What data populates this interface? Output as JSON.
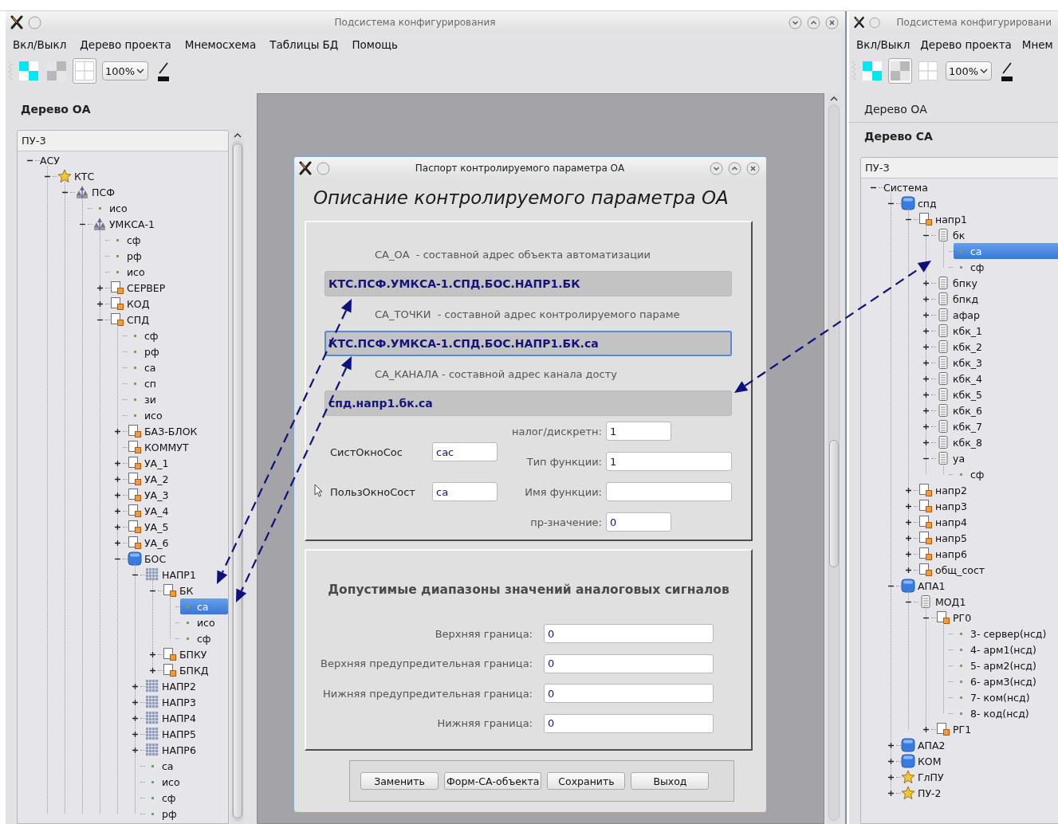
{
  "left_window": {
    "title": "Подсистема конфигурирования",
    "menu": [
      "Вкл/Выкл",
      "Дерево проекта",
      "Мнемосхема",
      "Таблицы БД",
      "Помощь"
    ],
    "toolbar": {
      "tools": [
        {
          "kind": "color",
          "pressed": false
        },
        {
          "kind": "shade",
          "pressed": false
        },
        {
          "kind": "grid",
          "pressed": true
        }
      ],
      "zoom": "100%"
    },
    "dock": {
      "sections": [
        {
          "label": "Дерево ОА",
          "selected": true
        }
      ],
      "tree": {
        "header": "ПУ-3",
        "nodes": [
          {
            "label": "АСУ",
            "expanded": true,
            "selected": false,
            "children": [
              {
                "label": "КТС",
                "kind": "star",
                "expanded": true,
                "selected": false,
                "children": [
                  {
                    "label": "ПСФ",
                    "kind": "network",
                    "expanded": true,
                    "selected": false,
                    "children": [
                      {
                        "label": "исо",
                        "kind": "dot",
                        "selected": false
                      },
                      {
                        "label": "УМКСА-1",
                        "kind": "network",
                        "expanded": true,
                        "selected": false,
                        "children": [
                          {
                            "label": "сф",
                            "kind": "dot",
                            "selected": false
                          },
                          {
                            "label": "рф",
                            "kind": "dot",
                            "selected": false
                          },
                          {
                            "label": "исо",
                            "kind": "dot",
                            "selected": false
                          },
                          {
                            "label": "СЕРВЕР",
                            "kind": "doc",
                            "expanded": false,
                            "selected": false
                          },
                          {
                            "label": "КОД",
                            "kind": "doc",
                            "expanded": false,
                            "selected": false
                          },
                          {
                            "label": "СПД",
                            "kind": "doc",
                            "expanded": true,
                            "selected": false,
                            "children": [
                              {
                                "label": "сф",
                                "kind": "dot",
                                "selected": false
                              },
                              {
                                "label": "рф",
                                "kind": "dot",
                                "selected": false
                              },
                              {
                                "label": "са",
                                "kind": "dot",
                                "selected": false
                              },
                              {
                                "label": "сп",
                                "kind": "dot",
                                "selected": false
                              },
                              {
                                "label": "зи",
                                "kind": "dot",
                                "selected": false
                              },
                              {
                                "label": "исо",
                                "kind": "dot",
                                "selected": false
                              },
                              {
                                "label": "БАЗ-БЛОК",
                                "kind": "doc",
                                "expanded": false,
                                "selected": false
                              },
                              {
                                "label": "КОММУТ",
                                "kind": "doc",
                                "selected": false
                              },
                              {
                                "label": "УА_1",
                                "kind": "doc",
                                "expanded": false,
                                "selected": false
                              },
                              {
                                "label": "УА_2",
                                "kind": "doc",
                                "expanded": false,
                                "selected": false
                              },
                              {
                                "label": "УА_3",
                                "kind": "doc",
                                "expanded": false,
                                "selected": false
                              },
                              {
                                "label": "УА_4",
                                "kind": "doc",
                                "expanded": false,
                                "selected": false
                              },
                              {
                                "label": "УА_5",
                                "kind": "doc",
                                "expanded": false,
                                "selected": false
                              },
                              {
                                "label": "УА_6",
                                "kind": "doc",
                                "expanded": false,
                                "selected": false
                              },
                              {
                                "label": "БОС",
                                "kind": "cube",
                                "expanded": true,
                                "selected": false,
                                "children": [
                                  {
                                    "label": "НАПР1",
                                    "kind": "grid",
                                    "expanded": true,
                                    "selected": false,
                                    "children": [
                                      {
                                        "label": "БК",
                                        "kind": "doc",
                                        "expanded": true,
                                        "selected": false,
                                        "children": [
                                          {
                                            "label": "са",
                                            "kind": "dot",
                                            "selected": true
                                          },
                                          {
                                            "label": "исо",
                                            "kind": "dot",
                                            "selected": false
                                          },
                                          {
                                            "label": "сф",
                                            "kind": "dot",
                                            "selected": false
                                          }
                                        ]
                                      },
                                      {
                                        "label": "БПКУ",
                                        "kind": "doc",
                                        "expanded": false,
                                        "selected": false
                                      },
                                      {
                                        "label": "БПКД",
                                        "kind": "doc",
                                        "expanded": false,
                                        "selected": false
                                      }
                                    ]
                                  },
                                  {
                                    "label": "НАПР2",
                                    "kind": "grid",
                                    "expanded": false,
                                    "selected": false
                                  },
                                  {
                                    "label": "НАПР3",
                                    "kind": "grid",
                                    "expanded": false,
                                    "selected": false
                                  },
                                  {
                                    "label": "НАПР4",
                                    "kind": "grid",
                                    "expanded": false,
                                    "selected": false
                                  },
                                  {
                                    "label": "НАПР5",
                                    "kind": "grid",
                                    "expanded": false,
                                    "selected": false
                                  },
                                  {
                                    "label": "НАПР6",
                                    "kind": "grid",
                                    "expanded": false,
                                    "selected": false
                                  },
                                  {
                                    "label": "са",
                                    "kind": "dot",
                                    "selected": false
                                  },
                                  {
                                    "label": "исо",
                                    "kind": "dot",
                                    "selected": false
                                  },
                                  {
                                    "label": "сф",
                                    "kind": "dot",
                                    "selected": false
                                  },
                                  {
                                    "label": "рф",
                                    "kind": "dot",
                                    "selected": false
                                  }
                                ]
                              }
                            ]
                          }
                        ]
                      }
                    ]
                  }
                ]
              }
            ]
          }
        ]
      }
    }
  },
  "dialog": {
    "title": "Паспорт контролируемого параметра ОА",
    "heading": "Описание контролируемого параметра ОА",
    "addresses": [
      {
        "label": "СА_ОА  - составной адрес объекта автоматизации",
        "value": "КТС.ПСФ.УМКСА-1.СПД.БОС.НАПР1.БК",
        "focused": false
      },
      {
        "label": "СА_ТОЧКИ  - составной адрес контролируемого параме",
        "value": "КТС.ПСФ.УМКСА-1.СПД.БОС.НАПР1.БК.са",
        "focused": true
      },
      {
        "label": "СА_КАНАЛА - составной адрес канала досту",
        "value": "спд.напр1.бк.са",
        "focused": false
      }
    ],
    "window_fields": [
      {
        "label": "СистОкноСос",
        "value": "сас"
      },
      {
        "label": "ПользОкноСост",
        "value": "са"
      }
    ],
    "function_fields": [
      {
        "label": "налог/дискретн:",
        "value": "1",
        "kind": "short"
      },
      {
        "label": "Тип функции:",
        "value": "1",
        "kind": "wide"
      },
      {
        "label": "Имя функции:",
        "kind": "wide"
      },
      {
        "label": "пр-значение:",
        "value": "0",
        "kind": "short"
      }
    ],
    "ranges": {
      "title": "Допустимые диапазоны значений аналоговых сигналов",
      "fields": [
        {
          "label": "Верхняя граница:",
          "value": "0"
        },
        {
          "label": "Верхняя предупредительная граница:",
          "value": "0"
        },
        {
          "label": "Нижняя предупредительная граница:",
          "value": "0"
        },
        {
          "label": "Нижняя граница:",
          "value": "0"
        }
      ]
    },
    "buttons": [
      "Заменить",
      "Форм-СА-объекта",
      "Сохранить",
      "Выход"
    ]
  },
  "right_window": {
    "title": "Подсистема конфигурировани",
    "menu": [
      "Вкл/Выкл",
      "Дерево проекта",
      "Мнем"
    ],
    "toolbar": {
      "tools": [
        {
          "kind": "color",
          "pressed": false
        },
        {
          "kind": "shade",
          "pressed": true
        },
        {
          "kind": "grid",
          "pressed": false
        }
      ],
      "zoom": "100%"
    },
    "dock": {
      "sections": [
        {
          "label": "Дерево ОА",
          "selected": false
        },
        {
          "label": "Дерево СА",
          "selected": true
        }
      ],
      "tree": {
        "header": "ПУ-3",
        "nodes": [
          {
            "label": "Система",
            "expanded": true,
            "selected": false,
            "children": [
              {
                "label": "спд",
                "kind": "cube",
                "expanded": true,
                "selected": false,
                "children": [
                  {
                    "label": "напр1",
                    "kind": "doc",
                    "expanded": true,
                    "selected": false,
                    "children": [
                      {
                        "label": "бк",
                        "kind": "db",
                        "expanded": true,
                        "selected": false,
                        "children": [
                          {
                            "label": "са",
                            "kind": "dot",
                            "selected": true
                          },
                          {
                            "label": "сф",
                            "kind": "dot",
                            "selected": false
                          }
                        ]
                      },
                      {
                        "label": "бпку",
                        "kind": "db",
                        "expanded": false,
                        "selected": false
                      },
                      {
                        "label": "бпкд",
                        "kind": "db",
                        "expanded": false,
                        "selected": false
                      },
                      {
                        "label": "афар",
                        "kind": "db",
                        "expanded": false,
                        "selected": false
                      },
                      {
                        "label": "кбк_1",
                        "kind": "db",
                        "expanded": false,
                        "selected": false
                      },
                      {
                        "label": "кбк_2",
                        "kind": "db",
                        "expanded": false,
                        "selected": false
                      },
                      {
                        "label": "кбк_3",
                        "kind": "db",
                        "expanded": false,
                        "selected": false
                      },
                      {
                        "label": "кбк_4",
                        "kind": "db",
                        "expanded": false,
                        "selected": false
                      },
                      {
                        "label": "кбк_5",
                        "kind": "db",
                        "expanded": false,
                        "selected": false
                      },
                      {
                        "label": "кбк_6",
                        "kind": "db",
                        "expanded": false,
                        "selected": false
                      },
                      {
                        "label": "кбк_7",
                        "kind": "db",
                        "expanded": false,
                        "selected": false
                      },
                      {
                        "label": "кбк_8",
                        "kind": "db",
                        "expanded": false,
                        "selected": false
                      },
                      {
                        "label": "уа",
                        "kind": "db",
                        "expanded": true,
                        "selected": false,
                        "children": [
                          {
                            "label": "сф",
                            "kind": "dot",
                            "selected": false
                          }
                        ]
                      }
                    ]
                  },
                  {
                    "label": "напр2",
                    "kind": "doc",
                    "expanded": false,
                    "selected": false
                  },
                  {
                    "label": "напр3",
                    "kind": "doc",
                    "expanded": false,
                    "selected": false
                  },
                  {
                    "label": "напр4",
                    "kind": "doc",
                    "expanded": false,
                    "selected": false
                  },
                  {
                    "label": "напр5",
                    "kind": "doc",
                    "expanded": false,
                    "selected": false
                  },
                  {
                    "label": "напр6",
                    "kind": "doc",
                    "expanded": false,
                    "selected": false
                  },
                  {
                    "label": "общ_сост",
                    "kind": "doc",
                    "expanded": false,
                    "selected": false
                  }
                ]
              },
              {
                "label": "АПА1",
                "kind": "cube",
                "expanded": true,
                "selected": false,
                "children": [
                  {
                    "label": "МОД1",
                    "kind": "db",
                    "expanded": true,
                    "selected": false,
                    "children": [
                      {
                        "label": "РГ0",
                        "kind": "doc",
                        "expanded": true,
                        "selected": false,
                        "children": [
                          {
                            "label": "3- сервер(нсд)",
                            "kind": "dot",
                            "selected": false
                          },
                          {
                            "label": "4- арм1(нсд)",
                            "kind": "dot",
                            "selected": false
                          },
                          {
                            "label": "5- арм2(нсд)",
                            "kind": "dot",
                            "selected": false
                          },
                          {
                            "label": "6- арм3(нсд)",
                            "kind": "dot",
                            "selected": false
                          },
                          {
                            "label": "7- ком(нсд)",
                            "kind": "dot",
                            "selected": false
                          },
                          {
                            "label": "8- код(нсд)",
                            "kind": "dot",
                            "selected": false
                          }
                        ]
                      },
                      {
                        "label": "РГ1",
                        "kind": "doc",
                        "expanded": false,
                        "selected": false
                      }
                    ]
                  }
                ]
              },
              {
                "label": "АПА2",
                "kind": "cube",
                "expanded": false,
                "selected": false
              },
              {
                "label": "КОМ",
                "kind": "cube",
                "expanded": false,
                "selected": false
              },
              {
                "label": "ГлПУ",
                "kind": "star",
                "expanded": false,
                "selected": false
              },
              {
                "label": "ПУ-2",
                "kind": "star",
                "expanded": false,
                "selected": false
              }
            ]
          }
        ]
      }
    }
  }
}
